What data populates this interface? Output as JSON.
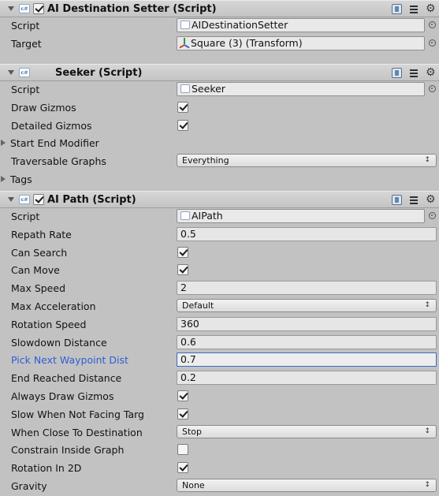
{
  "components": [
    {
      "title": "AI Destination Setter (Script)",
      "enabled": true,
      "properties": [
        {
          "label": "Script",
          "type": "script",
          "value": "AIDestinationSetter"
        },
        {
          "label": "Target",
          "type": "object",
          "value": "Square (3) (Transform)"
        }
      ]
    },
    {
      "title": "Seeker (Script)",
      "properties": [
        {
          "label": "Script",
          "type": "script",
          "value": "Seeker"
        },
        {
          "label": "Draw Gizmos",
          "type": "toggle",
          "checked": true
        },
        {
          "label": "Detailed Gizmos",
          "type": "toggle",
          "checked": true
        },
        {
          "label": "Start End Modifier",
          "type": "foldout"
        },
        {
          "label": "Traversable Graphs",
          "type": "dropdown",
          "value": "Everything"
        },
        {
          "label": "Tags",
          "type": "foldout"
        }
      ]
    },
    {
      "title": "AI Path (Script)",
      "enabled": true,
      "properties": [
        {
          "label": "Script",
          "type": "script",
          "value": "AIPath"
        },
        {
          "label": "Repath Rate",
          "type": "number",
          "value": "0.5"
        },
        {
          "label": "Can Search",
          "type": "toggle",
          "checked": true
        },
        {
          "label": "Can Move",
          "type": "toggle",
          "checked": true
        },
        {
          "label": "Max Speed",
          "type": "number",
          "value": "2"
        },
        {
          "label": "Max Acceleration",
          "type": "dropdown",
          "value": "Default"
        },
        {
          "label": "Rotation Speed",
          "type": "number",
          "value": "360"
        },
        {
          "label": "Slowdown Distance",
          "type": "number",
          "value": "0.6"
        },
        {
          "label": "Pick Next Waypoint Dist",
          "type": "number",
          "value": "0.7",
          "focused": true
        },
        {
          "label": "End Reached Distance",
          "type": "number",
          "value": "0.2"
        },
        {
          "label": "Always Draw Gizmos",
          "type": "toggle",
          "checked": true
        },
        {
          "label": "Slow When Not Facing Targ",
          "type": "toggle",
          "checked": true
        },
        {
          "label": "When Close To Destination",
          "type": "dropdown",
          "value": "Stop"
        },
        {
          "label": "Constrain Inside Graph",
          "type": "toggle",
          "checked": false
        },
        {
          "label": "Rotation In 2D",
          "type": "toggle",
          "checked": true
        },
        {
          "label": "Gravity",
          "type": "dropdown",
          "value": "None"
        }
      ]
    }
  ],
  "icons": {
    "csharp_script": "cs-script-icon",
    "help": "help-book-icon",
    "presets": "presets-icon",
    "settings": "gear-icon",
    "object_picker": "object-picker-icon",
    "transform": "transform-icon",
    "dropdown_arrow": "↕"
  },
  "colors": {
    "background": "#c2c2c2",
    "focused_label": "#2f5fd0",
    "focused_border": "#3d6bc4"
  }
}
